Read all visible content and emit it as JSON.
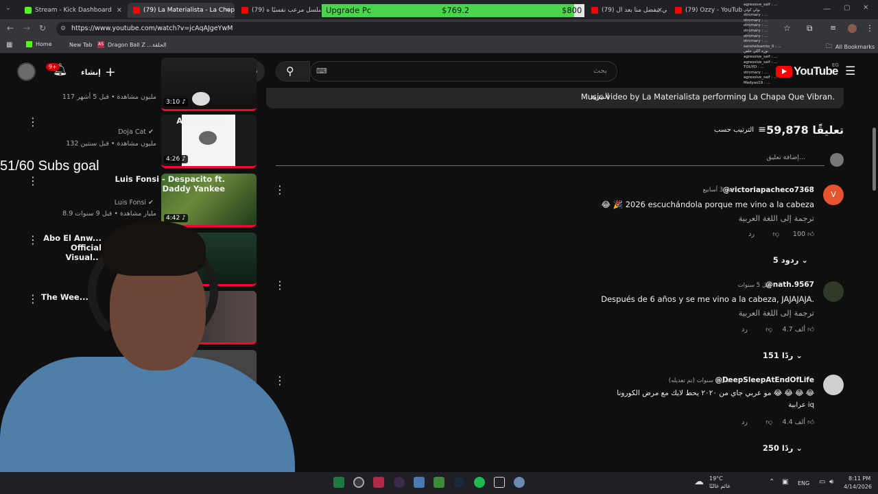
{
  "tabs": [
    {
      "label": "Stream - Kick Dashboard",
      "color": "#53fc18"
    },
    {
      "label": "(79) La Materialista - La Chapa",
      "color": "#ff0000"
    },
    {
      "label": "(79) أكثر مسلسل مرعب نفسيًا ه",
      "color": "#ff0000"
    },
    {
      "label": "(79) إيه اللي بيفضل منا بعد ال",
      "color": "#ff0000"
    },
    {
      "label": "(79) Ozzy - YouTube",
      "color": "#ff0000"
    }
  ],
  "upgrade": {
    "label": "Upgrade Pc",
    "current": "$769.2",
    "goal": "$800",
    "progress": 0.96
  },
  "address": {
    "url": "https://www.youtube.com/watch?v=jcAqAJgeYwM"
  },
  "bookmarks": {
    "home": "Home",
    "new_tab": "New Tab",
    "dragonball": "Dragon Ball Z ...الحلقة",
    "all": "All Bookmarks"
  },
  "header": {
    "create": "إنشاء",
    "notif_count": "9+",
    "search_placeholder": "بحث",
    "logo": "YouTube",
    "region": "EG"
  },
  "description": {
    "text": "Music video by La Materialista performing La Chapa Que Vibran.",
    "more": "...المزيد"
  },
  "comments_header": {
    "count": "59,878 تعليقًا",
    "sort": "الترتيب حسب",
    "add": "إضافة تعليق..."
  },
  "related": [
    {
      "title": "",
      "channel": "",
      "meta": "117 مليون مشاهدة • قبل 5 أشهر",
      "duration": "3:10"
    },
    {
      "title": "Agora Hills",
      "channel": "Doja Cat",
      "meta": "132 مليون مشاهدة • قبل سنتين",
      "duration": "4:26"
    },
    {
      "title": "Luis Fonsi - Despacito ft. Daddy Yankee",
      "channel": "Luis Fonsi",
      "meta": "8.9 مليار مشاهدة • قبل 9 سنوات",
      "duration": "4:42"
    },
    {
      "title": "Abo El Anw... Official Visual...",
      "channel": "",
      "meta": "",
      "duration": ""
    },
    {
      "title": "The Wee...",
      "channel": "",
      "meta": "",
      "duration": ""
    }
  ],
  "comments": [
    {
      "author": "@victoriapacheco7368",
      "time": "قبل 3 أسابيع",
      "text": "😂 🎉 2026 escuchándola porque me vino a la cabeza",
      "translate": "ترجمة إلى اللغة العربية",
      "likes": "100",
      "reply": "رد",
      "replies": "5 ردود",
      "avatar_letter": "V",
      "avatar_color": "#e8532f"
    },
    {
      "author": "@nath.9567",
      "time": "قبل 5 سنوات",
      "text": "Después de 6 años y se me vino a la cabeza, JAJAJAJA.",
      "translate": "ترجمة إلى اللغة العربية",
      "likes": "4.7 ألف",
      "reply": "رد",
      "replies": "151 ردًا",
      "avatar_letter": "",
      "avatar_color": "#2f3a2a"
    },
    {
      "author": "@DeepSleepAtEndOfLife",
      "time": "قبل 6 سنوات (تم تعديله)",
      "text": "مو عربي جاي من ٢٠٢٠ يحط لايك مع مرض الكورونا 😂 😂 😂 😂",
      "text2": "عرابية iq",
      "translate": "",
      "likes": "4.4 ألف",
      "reply": "رد",
      "replies": "250 ردًا",
      "avatar_letter": "",
      "avatar_color": "#cfcfcf"
    }
  ],
  "overlay": {
    "subs_goal": "51/60 Subs goal"
  },
  "chat": [
    "agressive_saif : ...",
    "بولي كولي",
    "stromary : ...",
    "stromary : ...",
    "stromary : ...",
    "stromary : ...",
    "stromary : ...",
    "stromary : ...",
    "sanshelsamto_0 : ...",
    "نوره اكلي خلص",
    "agressive_saif : ...",
    "agressive_saif : ...",
    "TOUYO : ...",
    "stromary : ...",
    "agressive_saif : ...",
    "Medyas19 : ..."
  ],
  "taskbar": {
    "weather_temp": "19°C",
    "weather_desc": "غائم غالبًا",
    "lang": "ENG",
    "time": "8:11 PM",
    "date": "4/14/2026"
  }
}
